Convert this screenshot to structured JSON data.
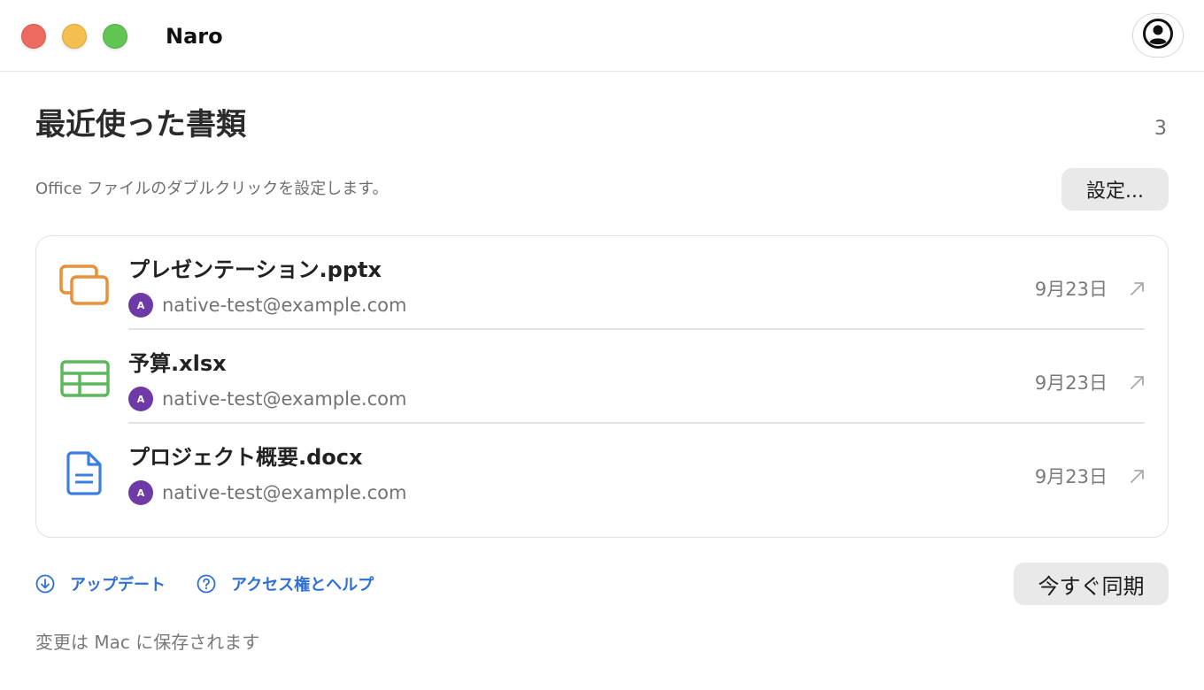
{
  "window": {
    "app_name": "Naro"
  },
  "header": {
    "title": "最近使った書類",
    "count": "3",
    "subtitle": "Office ファイルのダブルクリックを設定します。",
    "settings_label": "設定..."
  },
  "files": [
    {
      "name": "プレゼンテーション.pptx",
      "account_initial": "A",
      "account_email": "native-test@example.com",
      "date": "9月23日",
      "icon": "presentation-icon",
      "icon_color": "#e8913a"
    },
    {
      "name": "予算.xlsx",
      "account_initial": "A",
      "account_email": "native-test@example.com",
      "date": "9月23日",
      "icon": "spreadsheet-icon",
      "icon_color": "#5cb85c"
    },
    {
      "name": "プロジェクト概要.docx",
      "account_initial": "A",
      "account_email": "native-test@example.com",
      "date": "9月23日",
      "icon": "document-icon",
      "icon_color": "#3d7fe0"
    }
  ],
  "footer": {
    "update_label": "アップデート",
    "help_label": "アクセス権とヘルプ",
    "sync_label": "今すぐ同期",
    "status_note": "変更は Mac に保存されます"
  },
  "colors": {
    "accent_link": "#2f6fd6",
    "avatar": "#6e3aa6",
    "close": "#ec6a5e",
    "minimize": "#f4bf4f",
    "maximize": "#61c554"
  }
}
